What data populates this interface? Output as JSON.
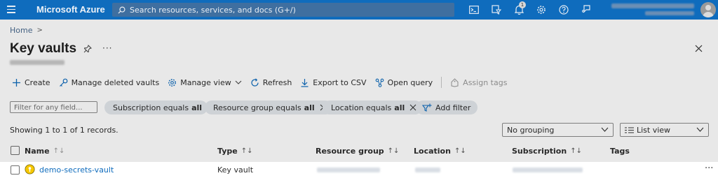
{
  "topbar": {
    "brand": "Microsoft Azure",
    "search_placeholder": "Search resources, services, and docs (G+/)",
    "notification_count": "1",
    "icons": [
      "cloud-shell-icon",
      "directory-filter-icon",
      "bell-icon",
      "gear-icon",
      "help-icon",
      "feedback-icon"
    ]
  },
  "breadcrumb": {
    "home": "Home",
    "separator": ">"
  },
  "page": {
    "title": "Key vaults",
    "more": "···"
  },
  "toolbar": {
    "create": "Create",
    "manage_deleted": "Manage deleted vaults",
    "manage_view": "Manage view",
    "refresh": "Refresh",
    "export_csv": "Export to CSV",
    "open_query": "Open query",
    "assign_tags": "Assign tags"
  },
  "filters": {
    "placeholder": "Filter for any field...",
    "pills": [
      {
        "label": "Subscription equals",
        "value": "all"
      },
      {
        "label": "Resource group equals",
        "value": "all"
      },
      {
        "label": "Location equals",
        "value": "all"
      }
    ],
    "add_filter": "Add filter"
  },
  "records_text": "Showing 1 to 1 of 1 records.",
  "grouping": {
    "selected": "No grouping"
  },
  "view": {
    "selected": "List view"
  },
  "table": {
    "columns": [
      "Name",
      "Type",
      "Resource group",
      "Location",
      "Subscription",
      "Tags"
    ],
    "sort_glyph": "↑↓",
    "rows": [
      {
        "name": "demo-secrets-vault",
        "type": "Key vault"
      }
    ]
  },
  "colors": {
    "topbar": "#0f6cbd",
    "link": "#0f6cbd",
    "pill": "#e3e7ec"
  }
}
